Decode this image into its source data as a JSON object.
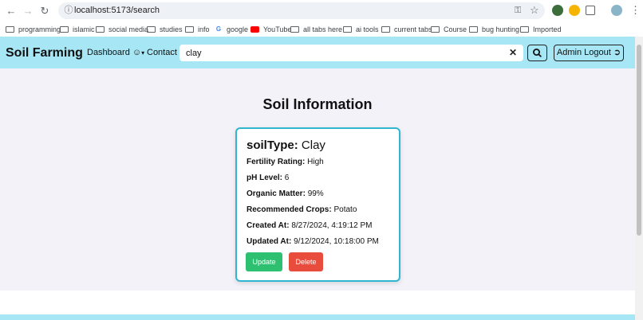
{
  "browser": {
    "url": "localhost:5173/search",
    "bookmarks": [
      {
        "label": "programming",
        "icon": "folder-icon"
      },
      {
        "label": "islamic",
        "icon": "folder-icon"
      },
      {
        "label": "social media",
        "icon": "folder-icon"
      },
      {
        "label": "studies",
        "icon": "folder-icon"
      },
      {
        "label": "info",
        "icon": "folder-icon"
      },
      {
        "label": "google",
        "icon": "google-icon"
      },
      {
        "label": "YouTube",
        "icon": "youtube-icon"
      },
      {
        "label": "all tabs here",
        "icon": "folder-icon"
      },
      {
        "label": "ai tools",
        "icon": "folder-icon"
      },
      {
        "label": "current tabs",
        "icon": "folder-icon"
      },
      {
        "label": "Course",
        "icon": "folder-icon"
      },
      {
        "label": "bug hunting",
        "icon": "folder-icon"
      },
      {
        "label": "Imported",
        "icon": "folder-icon"
      }
    ]
  },
  "nav": {
    "brand": "Soil Farming",
    "dashboard": "Dashboard",
    "contact": "Contact",
    "search_value": "clay",
    "logout": "Admin Logout"
  },
  "page": {
    "heading": "Soil Information"
  },
  "card": {
    "title_label": "soilType:",
    "title_value": "Clay",
    "fertility_label": "Fertility Rating:",
    "fertility_value": "High",
    "ph_label": "pH Level:",
    "ph_value": "6",
    "organic_label": "Organic Matter:",
    "organic_value": "99%",
    "crops_label": "Recommended Crops:",
    "crops_value": "Potato",
    "created_label": "Created At:",
    "created_value": "8/27/2024, 4:19:12 PM",
    "updated_label": "Updated At:",
    "updated_value": "9/12/2024, 10:18:00 PM",
    "update_button": "Update",
    "delete_button": "Delete"
  },
  "colors": {
    "nav_bg": "#a7e6f4",
    "card_border": "#2fb6d0",
    "update": "#2ec071",
    "delete": "#e74c3c"
  }
}
